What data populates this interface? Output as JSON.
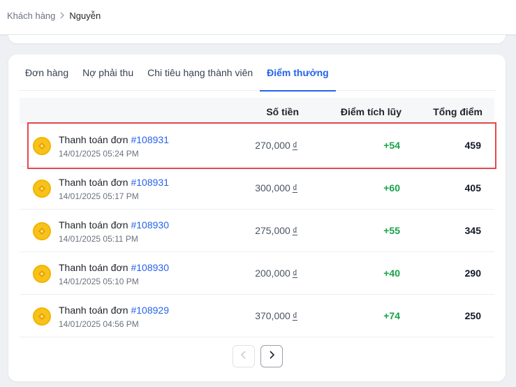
{
  "breadcrumb": {
    "parent": "Khách hàng",
    "current": "Nguyễn"
  },
  "tabs": [
    {
      "label": "Đơn hàng",
      "active": false
    },
    {
      "label": "Nợ phải thu",
      "active": false
    },
    {
      "label": "Chi tiêu hạng thành viên",
      "active": false
    },
    {
      "label": "Điểm thưởng",
      "active": true
    }
  ],
  "table": {
    "columns": {
      "amount": "Số tiền",
      "points": "Điểm tích lũy",
      "total": "Tổng điểm"
    },
    "rows": [
      {
        "title": "Thanh toán đơn",
        "order": "#108931",
        "time": "14/01/2025 05:24 PM",
        "amount": "270,000",
        "currency": "₫",
        "points": "+54",
        "total": "459"
      },
      {
        "title": "Thanh toán đơn",
        "order": "#108931",
        "time": "14/01/2025 05:17 PM",
        "amount": "300,000",
        "currency": "₫",
        "points": "+60",
        "total": "405"
      },
      {
        "title": "Thanh toán đơn",
        "order": "#108930",
        "time": "14/01/2025 05:11 PM",
        "amount": "275,000",
        "currency": "₫",
        "points": "+55",
        "total": "345"
      },
      {
        "title": "Thanh toán đơn",
        "order": "#108930",
        "time": "14/01/2025 05:10 PM",
        "amount": "200,000",
        "currency": "₫",
        "points": "+40",
        "total": "290"
      },
      {
        "title": "Thanh toán đơn",
        "order": "#108929",
        "time": "14/01/2025 04:56 PM",
        "amount": "370,000",
        "currency": "₫",
        "points": "+74",
        "total": "250"
      }
    ]
  },
  "pagination": {
    "prev_icon": "chevron-left-icon",
    "next_icon": "chevron-right-icon"
  },
  "colors": {
    "accent": "#2563eb",
    "positive": "#16a34a",
    "highlight": "#e5484d",
    "coin": "#f7c21a"
  }
}
